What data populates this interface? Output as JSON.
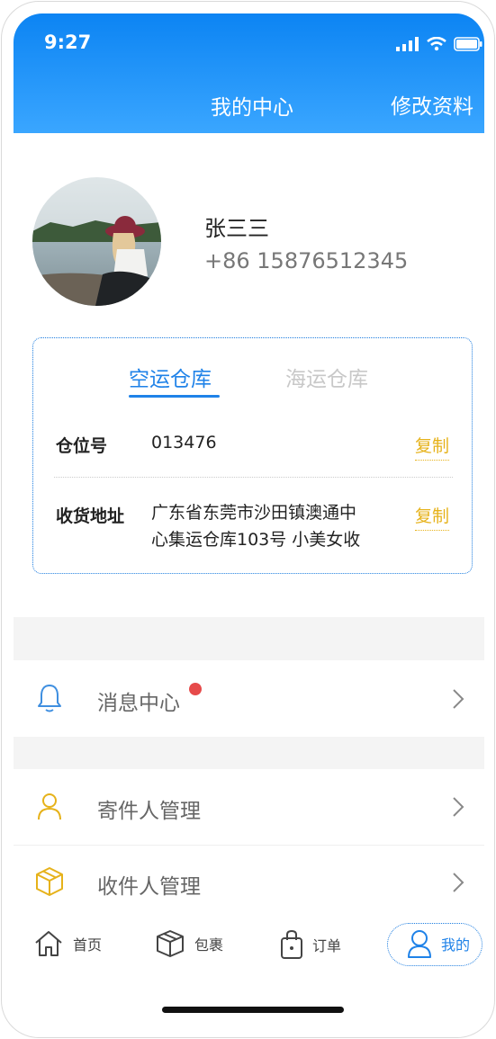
{
  "status_bar": {
    "time": "9:27"
  },
  "nav": {
    "title": "我的中心",
    "edit_label": "修改资料"
  },
  "user": {
    "name": "张三三",
    "phone": "+86 15876512345"
  },
  "warehouse_card": {
    "tabs": [
      {
        "label": "空运仓库",
        "active": true
      },
      {
        "label": "海运仓库",
        "active": false
      }
    ],
    "rows": [
      {
        "label": "仓位号",
        "value": "013476",
        "copy_label": "复制"
      },
      {
        "label": "收货地址",
        "value_line1": "广东省东莞市沙田镇澳通中",
        "value_line2": "心集运仓库103号 小美女收",
        "copy_label": "复制"
      }
    ]
  },
  "menu": {
    "messages": {
      "label": "消息中心",
      "has_unread": true
    },
    "sender": {
      "label": "寄件人管理"
    },
    "receiver": {
      "label": "收件人管理"
    }
  },
  "tab_bar": {
    "items": [
      {
        "label": "首页",
        "icon": "home-icon"
      },
      {
        "label": "包裹",
        "icon": "package-icon"
      },
      {
        "label": "订单",
        "icon": "order-bag-icon"
      },
      {
        "label": "我的",
        "icon": "user-icon",
        "active": true
      }
    ]
  },
  "colors": {
    "primary": "#1f82e8",
    "accent": "#e6b21a",
    "badge": "#e64a4a"
  }
}
